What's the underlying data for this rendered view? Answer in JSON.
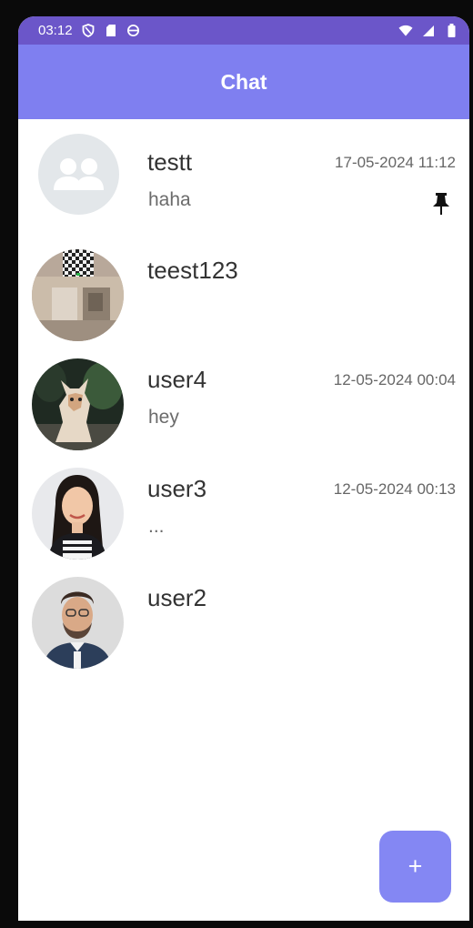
{
  "status_bar": {
    "time": "03:12",
    "left_icons": [
      "shield-icon",
      "sd-card-icon",
      "sync-icon"
    ],
    "right_icons": [
      "wifi-icon",
      "signal-icon",
      "battery-icon"
    ]
  },
  "app_bar": {
    "title": "Chat"
  },
  "chats": [
    {
      "name": "testt",
      "time": "17-05-2024 11:12",
      "preview": "haha",
      "pinned": true,
      "avatar": "group-avatar"
    },
    {
      "name": "teest123",
      "time": "",
      "preview": "",
      "pinned": false,
      "avatar": "room-photo-avatar"
    },
    {
      "name": "user4",
      "time": "12-05-2024 00:04",
      "preview": "hey",
      "pinned": false,
      "avatar": "cat-photo-avatar"
    },
    {
      "name": "user3",
      "time": "12-05-2024 00:13",
      "preview": "...",
      "pinned": false,
      "avatar": "woman-photo-avatar"
    },
    {
      "name": "user2",
      "time": "",
      "preview": "",
      "pinned": false,
      "avatar": "man-photo-avatar"
    }
  ],
  "fab": {
    "label": "+"
  },
  "colors": {
    "status_bar": "#6b56c9",
    "app_bar": "#7f7ff0",
    "fab": "#8487f3",
    "frame": "#0a0a0a"
  }
}
